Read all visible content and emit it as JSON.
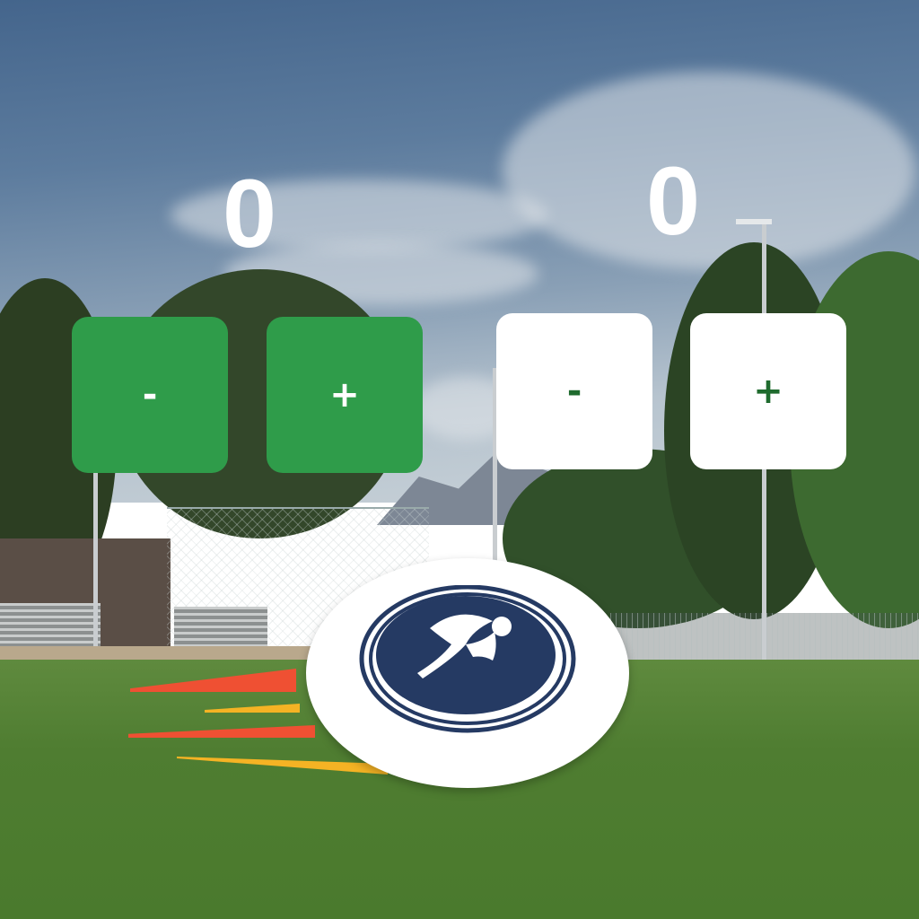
{
  "scoreboard": {
    "left_team": {
      "score": "0",
      "minus_label": "-",
      "plus_label": "+",
      "color": "#2f9c4a"
    },
    "right_team": {
      "score": "0",
      "minus_label": "-",
      "plus_label": "+",
      "color": "#ffffff"
    }
  },
  "logo": {
    "icon": "bird-logo-icon",
    "color": "#253a63"
  },
  "colors": {
    "streak_red": "#ef5033",
    "streak_yellow": "#f5b324",
    "accent_green": "#2f9c4a"
  }
}
